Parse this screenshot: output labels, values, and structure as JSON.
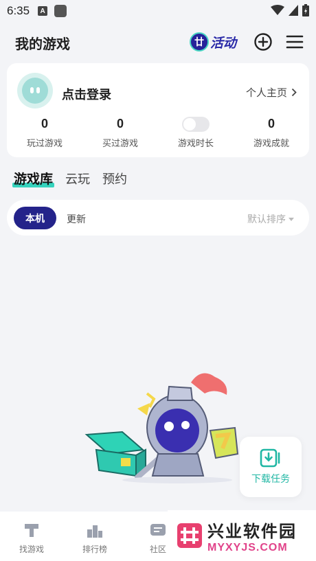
{
  "status_bar": {
    "time": "6:35",
    "app_letter": "A"
  },
  "header": {
    "title": "我的游戏",
    "activity_label": "活动",
    "activity_icon_text": "廿"
  },
  "profile": {
    "login_text": "点击登录",
    "profile_link": "个人主页",
    "stats": [
      {
        "value": "0",
        "label": "玩过游戏"
      },
      {
        "value": "0",
        "label": "买过游戏"
      },
      {
        "value": "",
        "label": "游戏时长"
      },
      {
        "value": "0",
        "label": "游戏成就"
      }
    ]
  },
  "tabs": [
    {
      "label": "游戏库",
      "active": true
    },
    {
      "label": "云玩",
      "active": false
    },
    {
      "label": "预约",
      "active": false
    }
  ],
  "filter": {
    "active_chip": "本机",
    "chip_update": "更新",
    "sort_label": "默认排序"
  },
  "download_fab": {
    "label": "下载任务"
  },
  "bottom_nav": [
    {
      "label": "找游戏",
      "icon": "hammer-icon"
    },
    {
      "label": "排行榜",
      "icon": "podium-icon"
    },
    {
      "label": "社区",
      "icon": "chat-icon"
    }
  ],
  "watermark": {
    "name": "兴业软件园",
    "url": "MYXYJS.COM"
  },
  "colors": {
    "accent": "#24238a",
    "teal": "#35d3bd",
    "background": "#f3f4f7"
  }
}
